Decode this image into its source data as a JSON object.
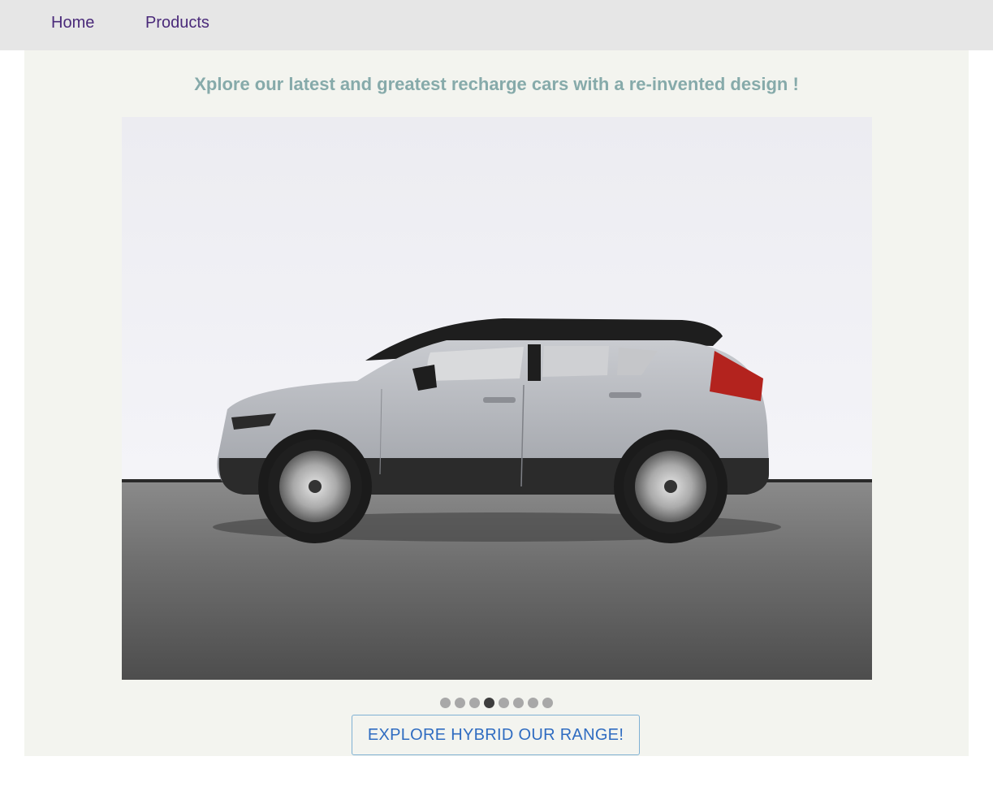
{
  "nav": {
    "items": [
      {
        "label": "Home"
      },
      {
        "label": "Products"
      }
    ]
  },
  "hero": {
    "headline": "Xplore our latest and greatest recharge cars with a re-invented design !",
    "image_alt": "silver electric SUV side view",
    "carousel": {
      "slide_count": 8,
      "active_index": 3
    },
    "cta_label": "EXPLORE HYBRID OUR RANGE!"
  },
  "colors": {
    "nav_bg": "#e6e6e6",
    "nav_link": "#4a2a7a",
    "content_bg": "#f3f4ef",
    "headline": "#86aaaa",
    "cta_text": "#2f6cc1",
    "cta_border": "#7fb1d3",
    "dot": "#a8a8a8",
    "dot_active": "#3e3e3e"
  }
}
